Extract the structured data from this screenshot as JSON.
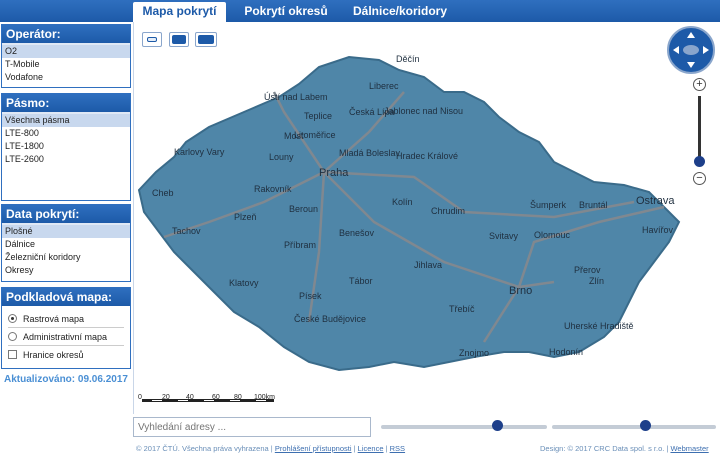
{
  "tabs": [
    {
      "label": "Mapa pokrytí",
      "active": true
    },
    {
      "label": "Pokrytí okresů",
      "active": false
    },
    {
      "label": "Dálnice/koridory",
      "active": false
    }
  ],
  "operator": {
    "title": "Operátor:",
    "items": [
      "O2",
      "T-Mobile",
      "Vodafone"
    ],
    "selected": 0
  },
  "band": {
    "title": "Pásmo:",
    "items": [
      "Všechna pásma",
      "LTE-800",
      "LTE-1800",
      "LTE-2600"
    ],
    "selected": 0
  },
  "coverage": {
    "title": "Data pokrytí:",
    "items": [
      "Plošné",
      "Dálnice",
      "Železniční koridory",
      "Okresy"
    ],
    "selected": 0
  },
  "basemap": {
    "title": "Podkladová mapa:",
    "raster": "Rastrová mapa",
    "admin": "Administrativní mapa",
    "districts": "Hranice okresů",
    "selected": "raster",
    "districts_checked": false
  },
  "updated": {
    "label": "Aktualizováno:",
    "date": "09.06.2017"
  },
  "map": {
    "cities": [
      {
        "name": "Ústí nad Labem"
      },
      {
        "name": "Liberec"
      },
      {
        "name": "Děčín"
      },
      {
        "name": "Jablonec nad Nisou"
      },
      {
        "name": "Česká Lípa"
      },
      {
        "name": "Teplice"
      },
      {
        "name": "Most"
      },
      {
        "name": "Litoměřice"
      },
      {
        "name": "Karlovy Vary"
      },
      {
        "name": "Louny"
      },
      {
        "name": "Mladá Boleslav"
      },
      {
        "name": "Hradec Králové"
      },
      {
        "name": "Praha"
      },
      {
        "name": "Rakovník"
      },
      {
        "name": "Cheb"
      },
      {
        "name": "Plzeň"
      },
      {
        "name": "Beroun"
      },
      {
        "name": "Kolín"
      },
      {
        "name": "Chrudim"
      },
      {
        "name": "Tachov"
      },
      {
        "name": "Benešov"
      },
      {
        "name": "Příbram"
      },
      {
        "name": "Svitavy"
      },
      {
        "name": "Olomouc"
      },
      {
        "name": "Šumperk"
      },
      {
        "name": "Bruntál"
      },
      {
        "name": "Ostrava"
      },
      {
        "name": "Havířov"
      },
      {
        "name": "Jihlava"
      },
      {
        "name": "Přerov"
      },
      {
        "name": "Klatovy"
      },
      {
        "name": "Písek"
      },
      {
        "name": "Tábor"
      },
      {
        "name": "Brno"
      },
      {
        "name": "Zlín"
      },
      {
        "name": "Třebíč"
      },
      {
        "name": "České Budějovice"
      },
      {
        "name": "Uherské Hradiště"
      },
      {
        "name": "Znojmo"
      },
      {
        "name": "Hodonín"
      }
    ],
    "scale_labels": [
      "0",
      "20",
      "40",
      "60",
      "80",
      "100km"
    ],
    "coverage_color": "#4f86a8",
    "road_color": "#808890"
  },
  "search": {
    "placeholder": "Vyhledání adresy ..."
  },
  "sliders": [
    {
      "value": 0.7
    },
    {
      "value": 0.57
    }
  ],
  "footer": {
    "copyright": "© 2017 ČTÚ. Všechna práva vyhrazena",
    "links": [
      "Prohlášení přístupnosti",
      "Licence",
      "RSS"
    ],
    "design": "Design: © 2017 CRC Data spol. s r.o.",
    "webmaster": "Webmaster"
  }
}
